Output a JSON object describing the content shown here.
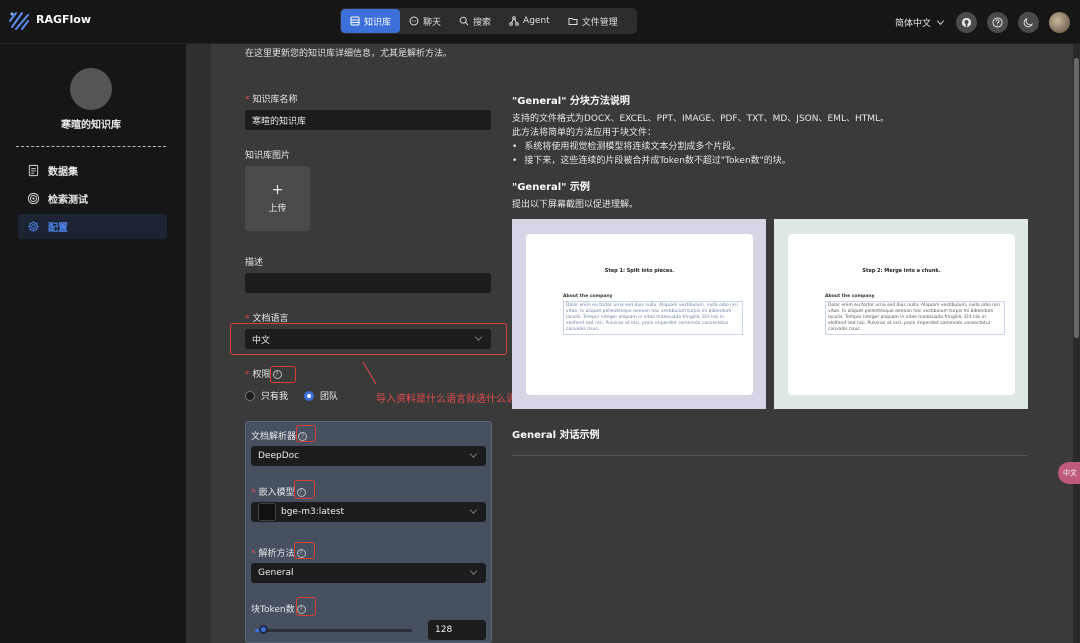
{
  "brand": {
    "name": "RAGFlow"
  },
  "nav": {
    "items": [
      {
        "label": "知识库",
        "icon": "database-icon",
        "active": true
      },
      {
        "label": "聊天",
        "icon": "chat-icon",
        "active": false
      },
      {
        "label": "搜索",
        "icon": "search-icon",
        "active": false
      },
      {
        "label": "Agent",
        "icon": "agent-icon",
        "active": false
      },
      {
        "label": "文件管理",
        "icon": "folder-icon",
        "active": false
      }
    ]
  },
  "header": {
    "language": "简体中文"
  },
  "sidebar": {
    "kb_name": "寒暄的知识库",
    "items": [
      {
        "label": "数据集",
        "icon": "document-icon",
        "active": false
      },
      {
        "label": "检索测试",
        "icon": "target-icon",
        "active": false
      },
      {
        "label": "配置",
        "icon": "gear-icon",
        "active": true
      }
    ]
  },
  "form": {
    "intro": "在这里更新您的知识库详细信息，尤其是解析方法。",
    "name_label": "知识库名称",
    "name_value": "寒暄的知识库",
    "image_label": "知识库图片",
    "upload_plus": "+",
    "upload_label": "上传",
    "description_label": "描述",
    "description_value": "",
    "language_label": "文档语言",
    "language_value": "中文",
    "permission_label": "权限",
    "permission_options": [
      "只有我",
      "团队"
    ],
    "permission_selected": "团队",
    "annotation": "导入资料是什么语言就选什么语言，如果英语中文都有就选中文",
    "parser_label": "文档解析器",
    "parser_value": "DeepDoc",
    "embed_label": "嵌入模型",
    "embed_value": "bge-m3:latest",
    "method_label": "解析方法",
    "method_value": "General",
    "chunk_label": "块Token数",
    "chunk_value": "128",
    "chunk_fraction": 0.05
  },
  "guide": {
    "title": "\"General\" 分块方法说明",
    "formats": "支持的文件格式为DOCX、EXCEL、PPT、IMAGE、PDF、TXT、MD、JSON、EML、HTML。",
    "method_intro": "此方法将简单的方法应用于块文件：",
    "bullets": [
      "系统将使用视觉检测模型将连续文本分割成多个片段。",
      "接下来，这些连续的片段被合并成Token数不超过\"Token数\"的块。"
    ],
    "example_title": "\"General\" 示例",
    "example_desc": "提出以下屏幕截图以促进理解。",
    "example_left": {
      "title": "Step 1: Split into pieces.",
      "head": "About the company",
      "text": "Dolor enim eu tortor urna sed duis nulla. Aliquam vestibulum, nulla odio nisi vitae. In aliquet pellentesque aenean hac vestibulum turpis mi bibendum iaculis. Tempor integer aliquam in vitae malesuada fringilla. Elit nisi in eleifend sed nisi. Pulvinar at orci, proin imperdiet commodo consectetur convallis risus."
    },
    "example_right": {
      "title": "Step 2: Merge into a chunk.",
      "head": "About the company",
      "text": "Dolor enim eu tortor urna sed duis nulla. Aliquam vestibulum, nulla odio nisi vitae. In aliquet pellentesque aenean hac vestibulum turpis mi bibendum iaculis. Tempor integer aliquam in vitae malesuada fringilla. Elit nisi in eleifend sed nisi. Pulvinar at orci, proin imperdiet commodo consectetur convallis risus."
    },
    "dialog_title": "General 对话示例"
  },
  "floating_badge": "中文"
}
